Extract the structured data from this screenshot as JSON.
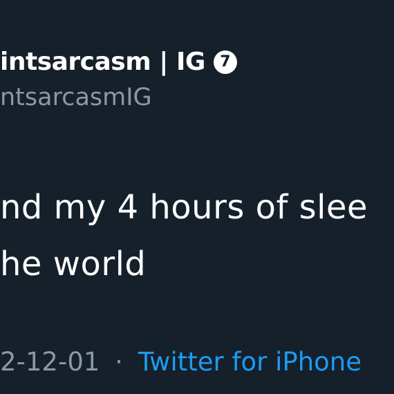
{
  "tweet": {
    "display_name": "intsarcasm | IG",
    "badge_label": "7",
    "handle": "ntsarcasmIG",
    "text_lines": [
      "nd my 4 hours of slee",
      "he world"
    ],
    "date": "2-12-01",
    "separator": "·",
    "source": "Twitter for iPhone"
  },
  "colors": {
    "background": "#15202b",
    "primary_text": "#ffffff",
    "secondary_text": "#8b98a5",
    "link": "#1d9bf0"
  }
}
